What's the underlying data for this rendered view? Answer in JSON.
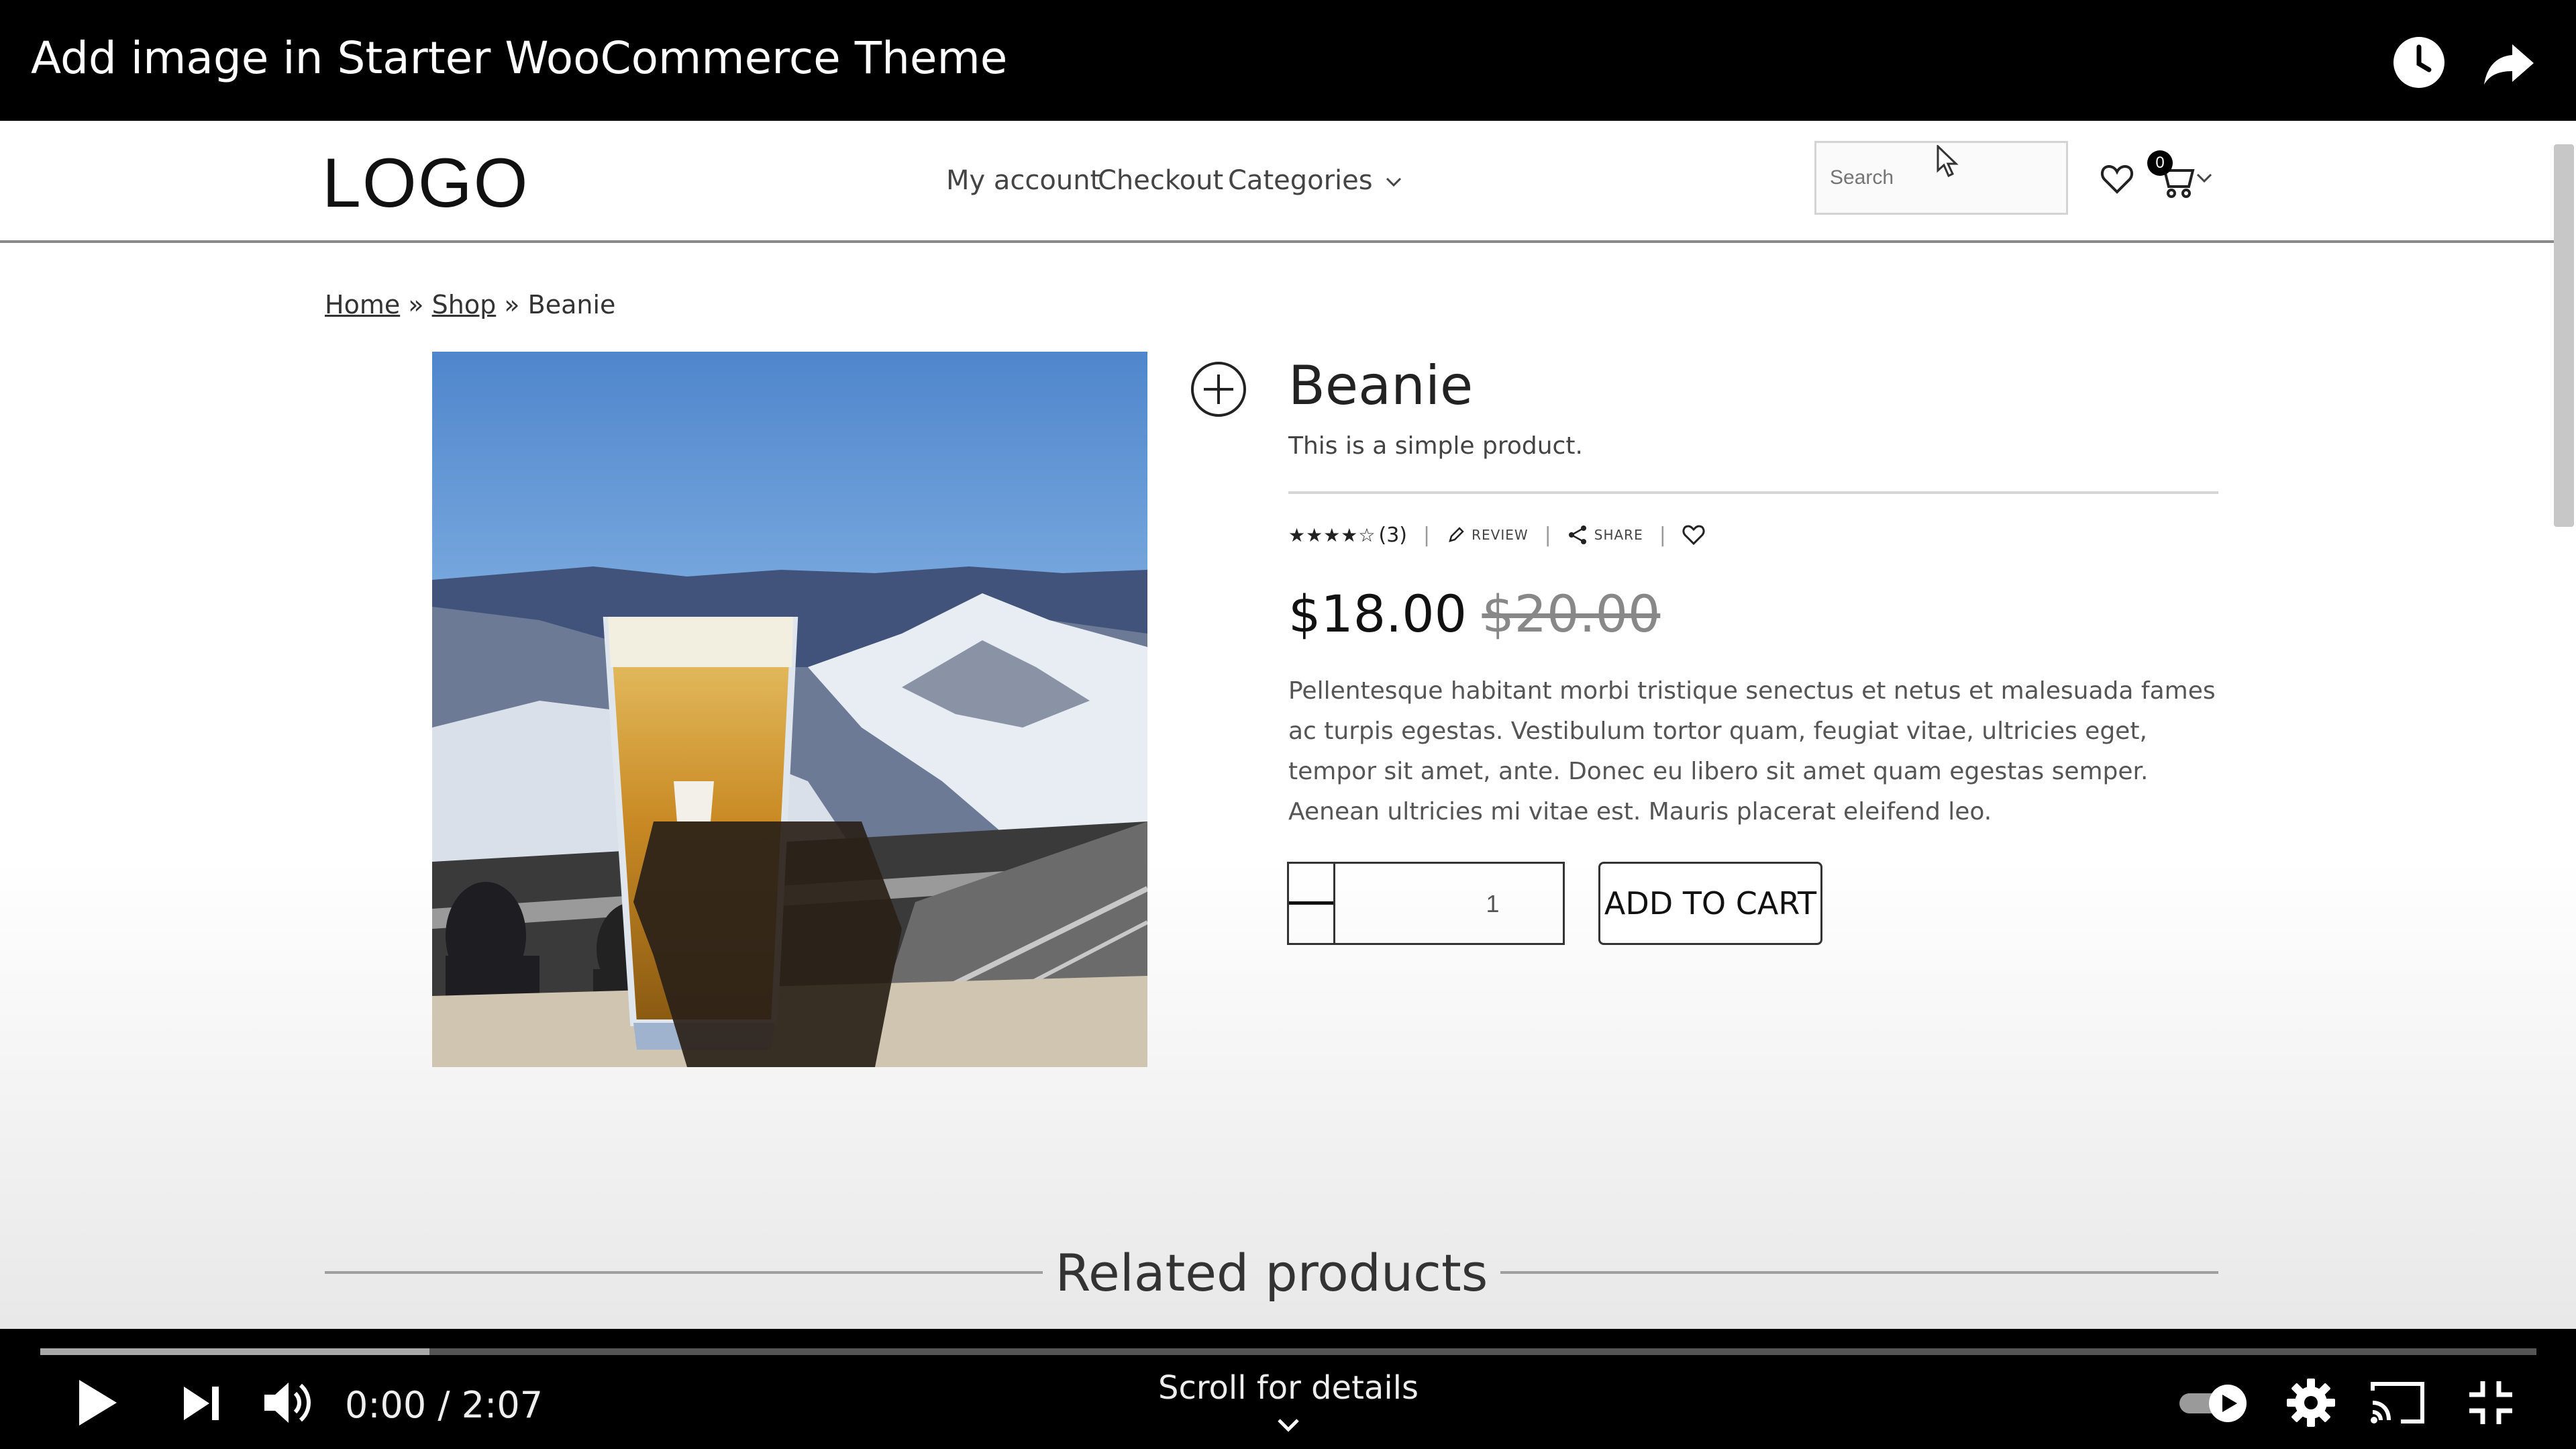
{
  "player": {
    "title": "Add image in Starter WooCommerce Theme",
    "time_display": "0:00 / 2:07",
    "scroll_hint": "Scroll for details",
    "progress_loaded_fraction": 0.156,
    "icons": [
      "watch-later-icon",
      "share-icon",
      "play-icon",
      "next-icon",
      "volume-icon",
      "autoplay-toggle-icon",
      "settings-gear-icon",
      "cast-icon",
      "exit-fullscreen-icon",
      "chevron-down-icon"
    ]
  },
  "site": {
    "logo": "LOGO",
    "nav": {
      "my_account": "My account",
      "checkout": "Checkout",
      "categories": "Categories"
    },
    "search_placeholder": "Search",
    "cart_count": "0"
  },
  "breadcrumb": {
    "home": "Home",
    "sep1": " » ",
    "shop": "Shop",
    "sep2": " » ",
    "current": "Beanie"
  },
  "product": {
    "title": "Beanie",
    "short_description": "This is a simple product.",
    "rating_stars": "★★★★☆",
    "rating_count": "(3)",
    "review_label": "REVIEW",
    "share_label": "SHARE",
    "price": "$18.00",
    "regular_price": "$20.00",
    "description": "Pellentesque habitant morbi tristique senectus et netus et malesuada fames ac turpis egestas. Vestibulum tortor quam, feugiat vitae, ultricies eget, tempor sit amet, ante. Donec eu libero sit amet quam egestas semper. Aenean ultricies mi vitae est. Mauris placerat eleifend leo.",
    "quantity": "1",
    "add_to_cart": "ADD TO CART"
  },
  "related": {
    "title": "Related products"
  },
  "colors": {
    "player_bg": "#000000",
    "page_bg": "#ffffff",
    "text": "#222222"
  }
}
